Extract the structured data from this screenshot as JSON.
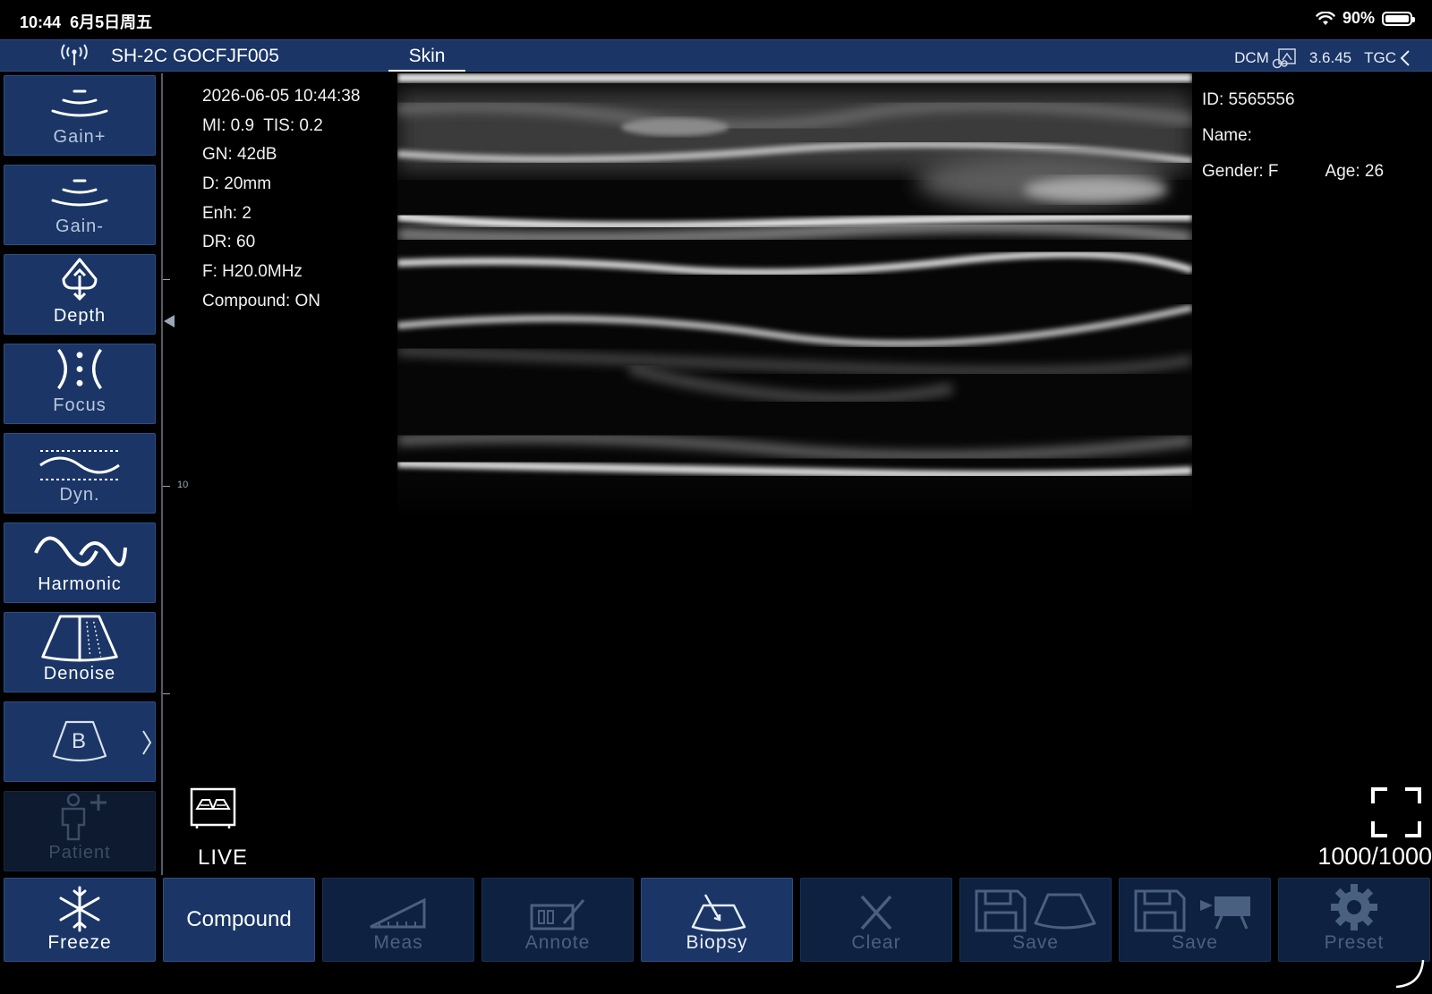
{
  "status_bar": {
    "time": "10:44",
    "date": "6月5日周五",
    "battery": "90%"
  },
  "header": {
    "device": "SH-2C GOCFJF005",
    "preset": "Skin",
    "dcm": "DCM",
    "version": "3.6.45",
    "tgc": "TGC"
  },
  "side_buttons": {
    "gain_plus": "Gain+",
    "gain_minus": "Gain-",
    "depth": "Depth",
    "focus": "Focus",
    "dyn": "Dyn.",
    "harmonic": "Harmonic",
    "denoise": "Denoise",
    "mode": "B",
    "patient": "Patient"
  },
  "scan_info": {
    "datetime": "2026-06-05 10:44:38",
    "mi_tis": "MI: 0.9  TIS: 0.2",
    "gain": "GN: 42dB",
    "depth": "D: 20mm",
    "enh": "Enh: 2",
    "dr": "DR: 60",
    "freq": "F: H20.0MHz",
    "compound": "Compound: ON"
  },
  "scale": {
    "label_10": "10"
  },
  "patient_info": {
    "id": "ID: 5565556",
    "name": "Name:",
    "gender": "Gender: F",
    "age": "Age: 26"
  },
  "live_label": "LIVE",
  "frame_counter": "1000/1000",
  "bottom_buttons": {
    "freeze": "Freeze",
    "compound": "Compound",
    "meas": "Meas",
    "annote": "Annote",
    "biopsy": "Biopsy",
    "clear": "Clear",
    "save_image": "Save",
    "save_video": "Save",
    "preset": "Preset"
  },
  "colors": {
    "panel_blue": "#1a3566",
    "panel_border": "#2e4f84",
    "disabled_text": "#4a6080"
  }
}
